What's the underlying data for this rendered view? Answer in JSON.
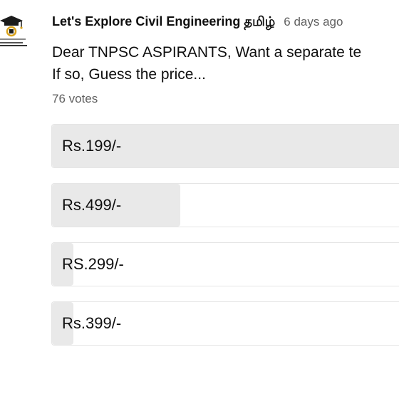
{
  "post": {
    "channel_name": "Let's Explore Civil Engineering தமிழ்",
    "timestamp": "6 days ago",
    "text_line1": "Dear TNPSC ASPIRANTS, Want a separate te",
    "text_line2": "If so, Guess the price...",
    "votes": "76 votes",
    "avatar_icon": "graduation-cap-logo",
    "avatar_text": "LET'S EXPLORE CIVIL ENGINEERING"
  },
  "poll": {
    "options": [
      {
        "label": "Rs.199/-",
        "fill_fraction": 1.0
      },
      {
        "label": "Rs.499/-",
        "fill_fraction": 0.36
      },
      {
        "label": "RS.299/-",
        "fill_fraction": 0.06
      },
      {
        "label": "Rs.399/-",
        "fill_fraction": 0.06
      }
    ]
  },
  "colors": {
    "fill": "#e9e9e9",
    "border": "#e5e5e5",
    "secondary_text": "#606060"
  }
}
